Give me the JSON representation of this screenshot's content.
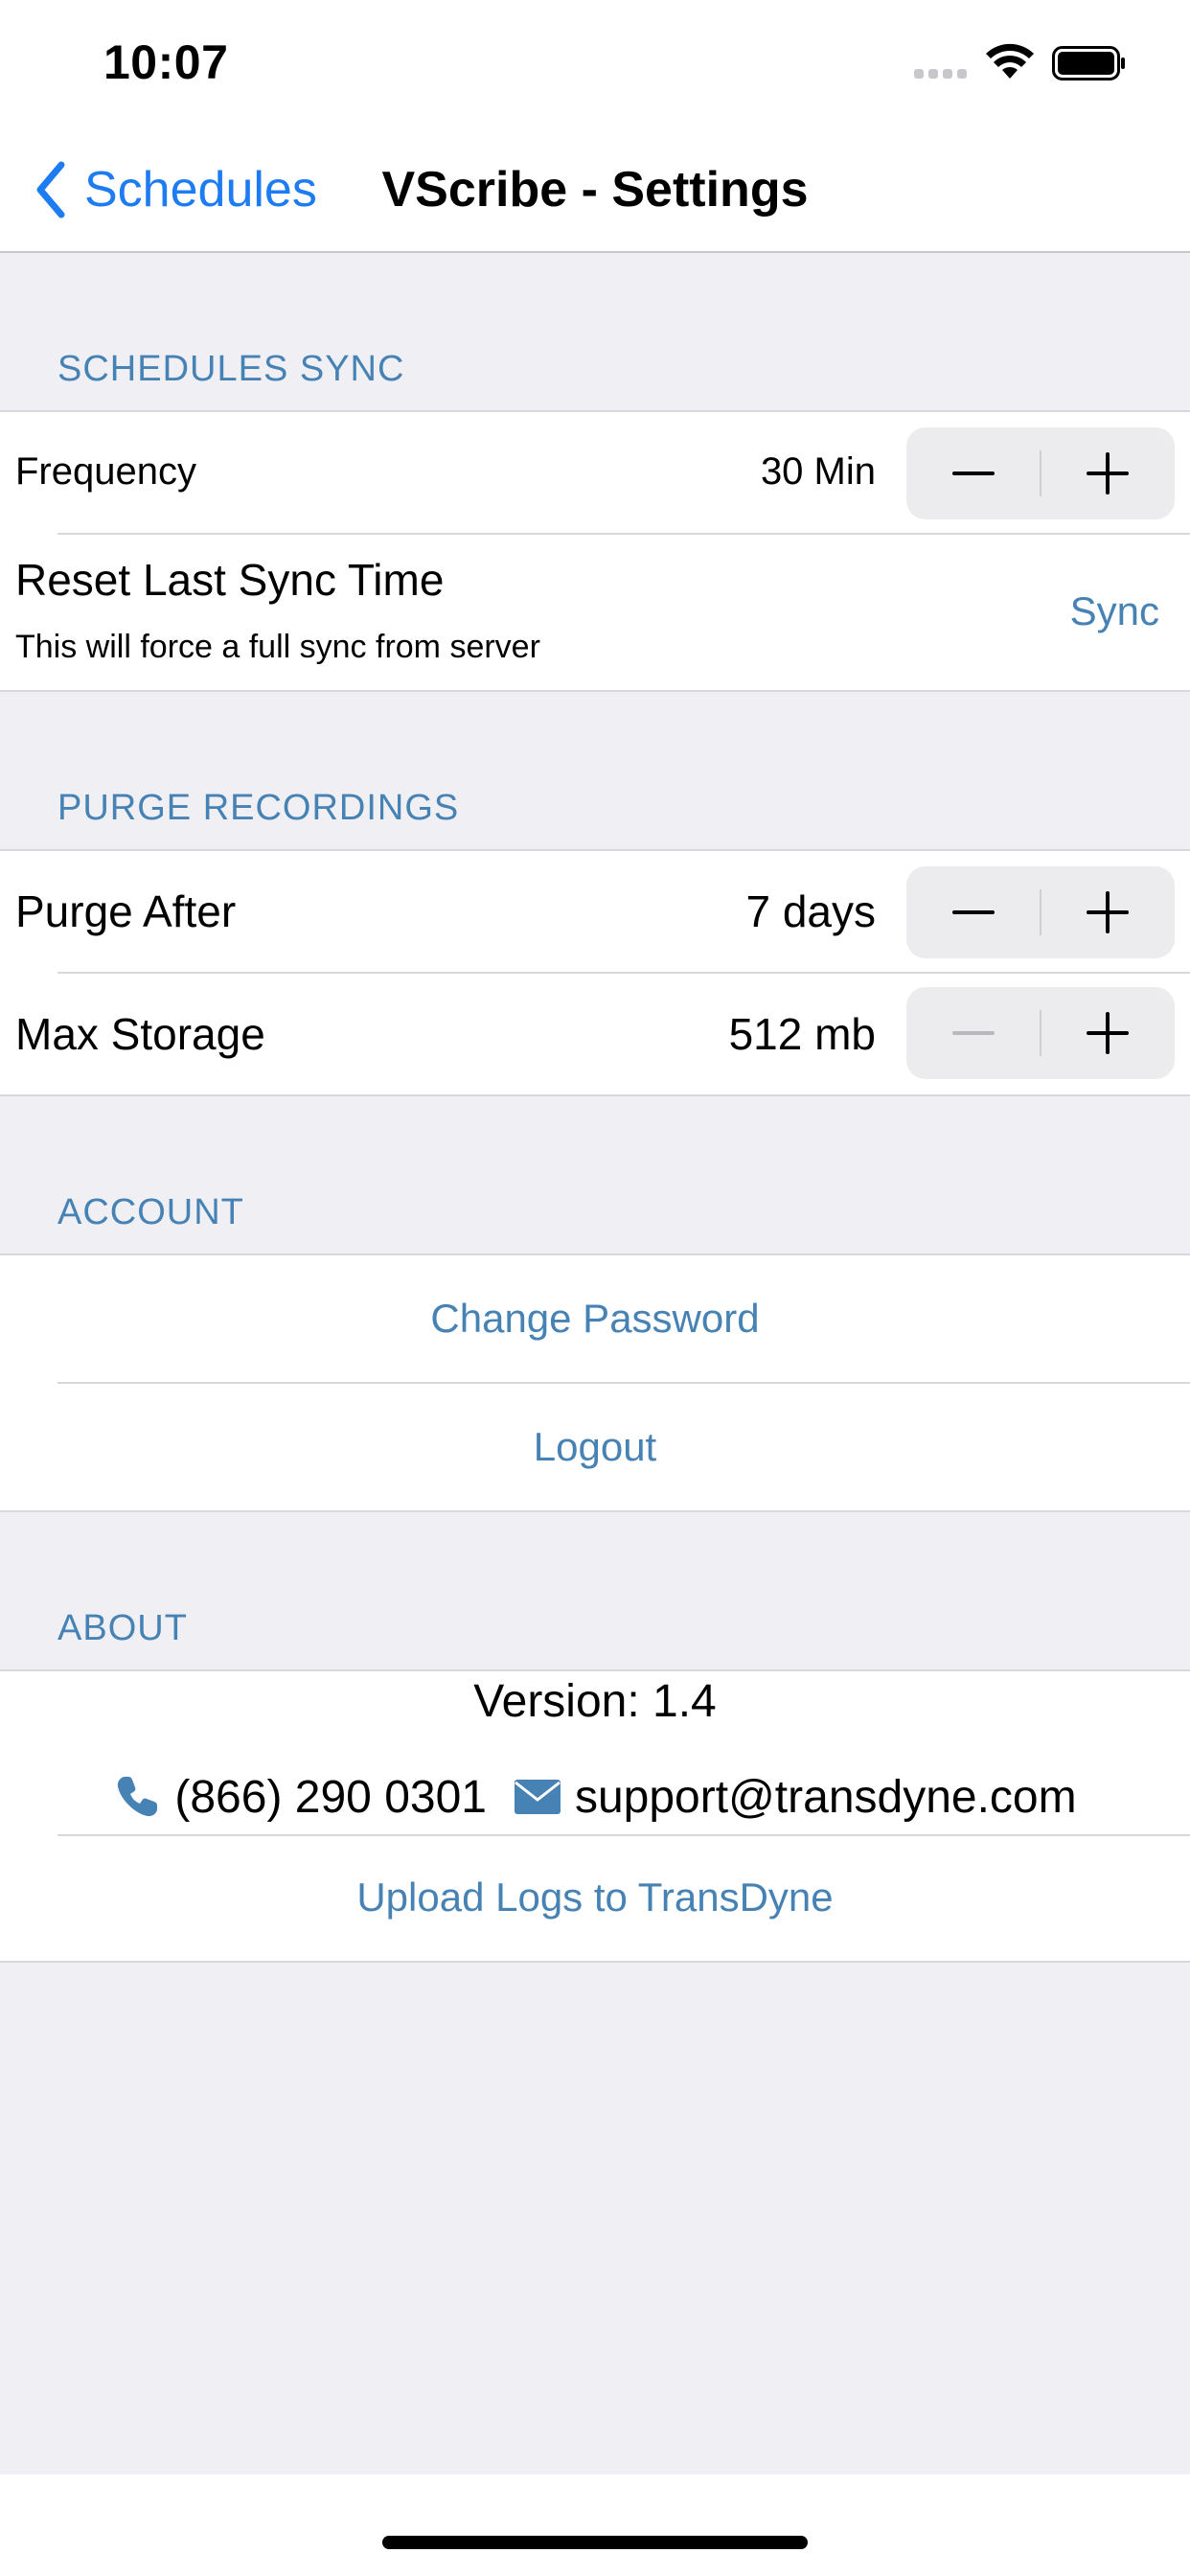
{
  "status_bar": {
    "time": "10:07",
    "icons": [
      "signal-dots-icon",
      "wifi-icon",
      "battery-icon"
    ]
  },
  "nav": {
    "back_label": "Schedules",
    "title": "VScribe - Settings"
  },
  "sections": {
    "schedules_sync": {
      "header": "SCHEDULES SYNC",
      "frequency": {
        "label": "Frequency",
        "value": "30 Min"
      },
      "reset": {
        "title": "Reset Last Sync Time",
        "subtitle": "This will force a full sync from server",
        "action": "Sync"
      }
    },
    "purge": {
      "header": "PURGE RECORDINGS",
      "purge_after": {
        "label": "Purge After",
        "value": "7 days"
      },
      "max_storage": {
        "label": "Max Storage",
        "value": "512 mb"
      }
    },
    "account": {
      "header": "ACCOUNT",
      "change_password": "Change Password",
      "logout": "Logout"
    },
    "about": {
      "header": "ABOUT",
      "version": "Version: 1.4",
      "phone": "(866) 290 0301",
      "email": "support@transdyne.com",
      "upload_logs": "Upload Logs to TransDyne"
    }
  },
  "colors": {
    "accent_link": "#4682b4",
    "back_blue": "#1d7cf2",
    "background": "#efeff4"
  }
}
